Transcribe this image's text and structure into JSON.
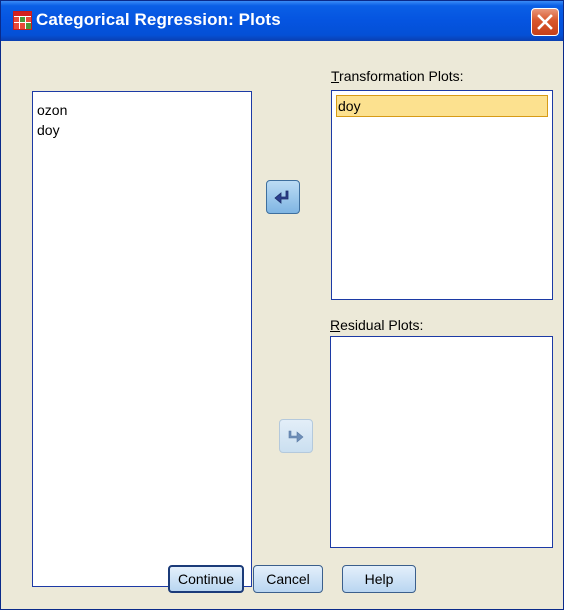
{
  "window": {
    "title": "Categorical Regression: Plots"
  },
  "source_list": {
    "items": [
      "ozon",
      "doy"
    ]
  },
  "transformation_plots": {
    "label_mnemonic": "T",
    "label_rest": "ransformation Plots:",
    "items": [
      "doy"
    ]
  },
  "residual_plots": {
    "label_mnemonic": "R",
    "label_rest": "esidual Plots:",
    "items": []
  },
  "buttons": {
    "continue": "Continue",
    "cancel": "Cancel",
    "help": "Help"
  },
  "colors": {
    "title_bar": "#0554e0",
    "dialog_bg": "#ece9d8",
    "selection_bg": "#fce18f",
    "list_border": "#1c3aa5"
  }
}
